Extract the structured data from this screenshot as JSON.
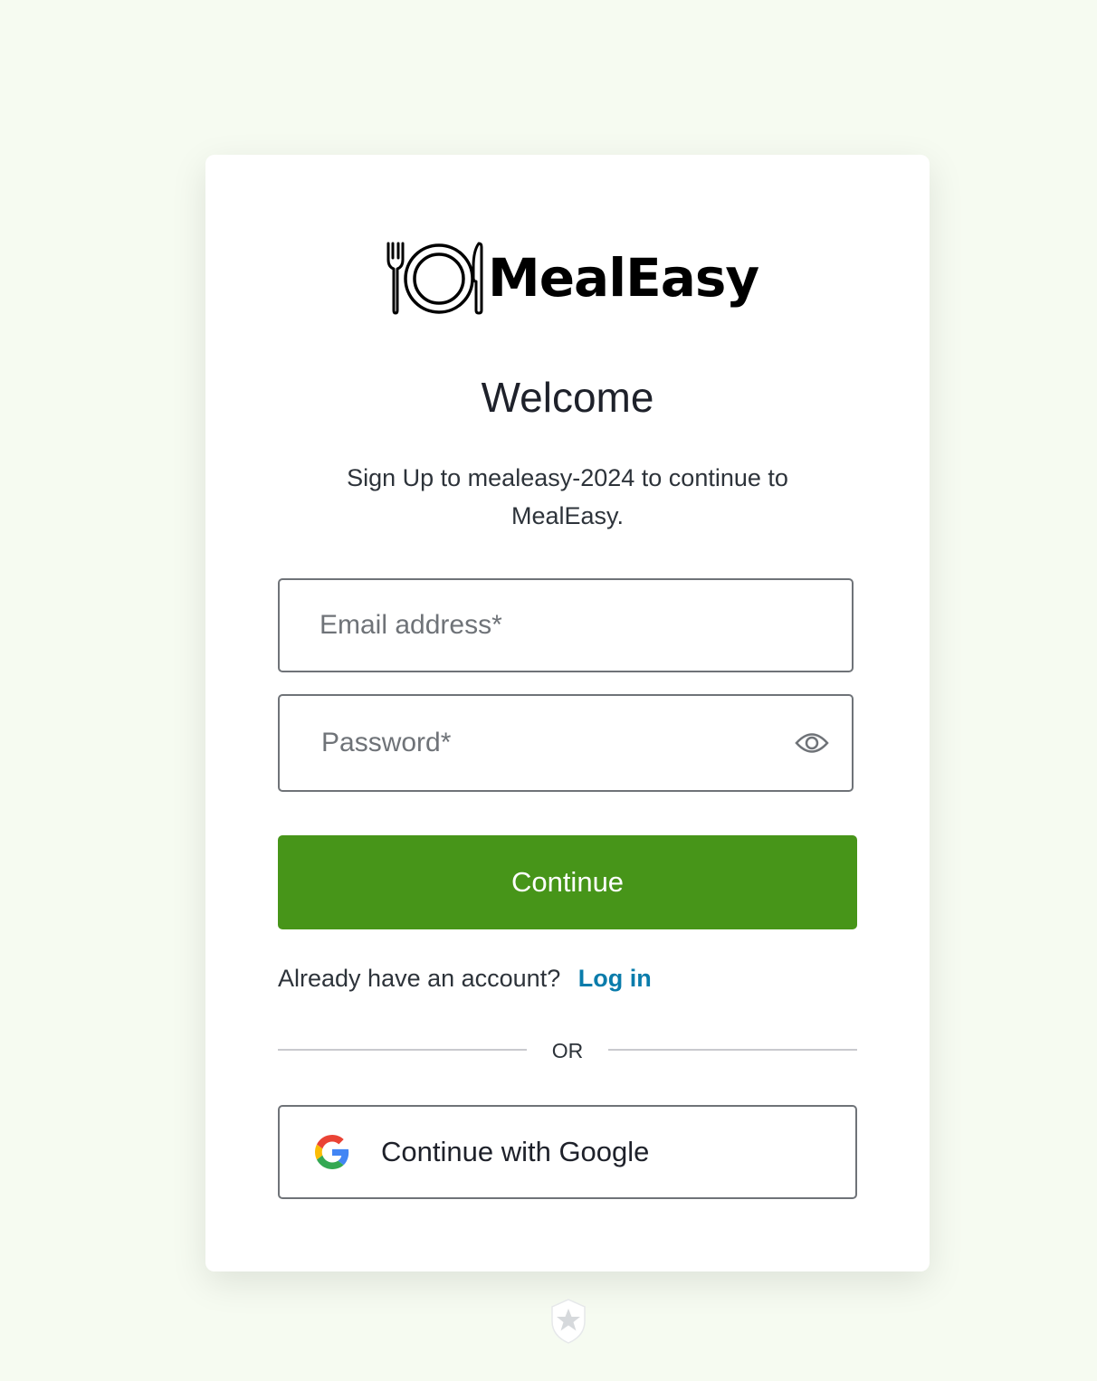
{
  "brand": {
    "name": "MealEasy",
    "logo_icon": "plate-fork-knife-icon"
  },
  "heading": {
    "title": "Welcome",
    "subtitle": "Sign Up to mealeasy-2024 to continue to MealEasy."
  },
  "form": {
    "email": {
      "placeholder": "Email address*",
      "value": ""
    },
    "password": {
      "placeholder": "Password*",
      "value": "",
      "toggle_icon": "eye-icon"
    },
    "continue_label": "Continue"
  },
  "login_prompt": {
    "text": "Already have an account?",
    "link_label": "Log in"
  },
  "divider_label": "OR",
  "social": {
    "google_label": "Continue with Google",
    "google_icon": "google-icon"
  },
  "footer": {
    "badge_icon": "shield-star-icon"
  },
  "colors": {
    "background": "#f6fbf1",
    "primary": "#479519",
    "link": "#0a7cab",
    "text": "#2d333a"
  }
}
